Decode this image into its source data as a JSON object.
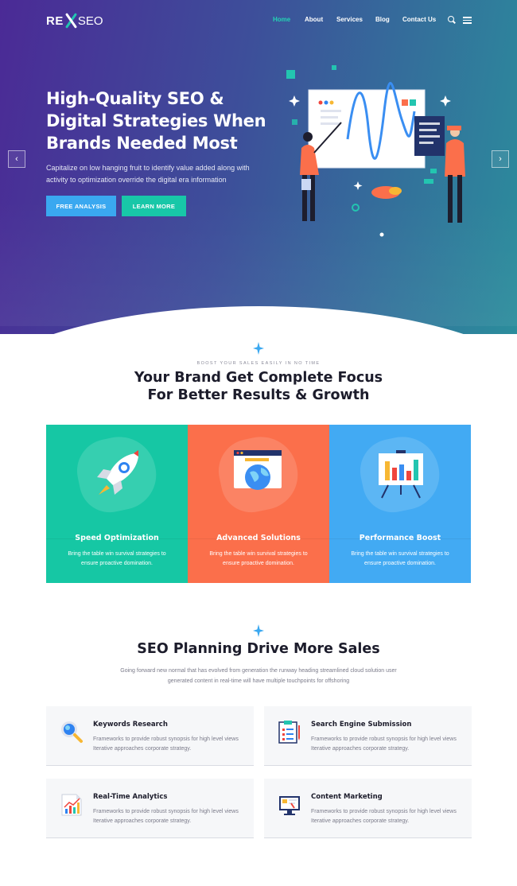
{
  "brand": {
    "logo_re": "RE",
    "logo_seo": "SEO"
  },
  "nav": {
    "items": [
      {
        "label": "Home",
        "active": true
      },
      {
        "label": "About",
        "active": false
      },
      {
        "label": "Services",
        "active": false
      },
      {
        "label": "Blog",
        "active": false
      },
      {
        "label": "Contact Us",
        "active": false
      }
    ],
    "icons": [
      "search-icon",
      "menu-icon"
    ]
  },
  "hero": {
    "title": "High-Quality SEO & Digital Strategies When Brands Needed Most",
    "subtitle": "Capitalize on low hanging fruit to identify value added along with activity to optimization override the digital era information",
    "primary_button": "FREE ANALYSIS",
    "secondary_button": "LEARN MORE",
    "prev_arrow": "‹",
    "next_arrow": "›"
  },
  "focus": {
    "kicker": "BOOST YOUR SALES EASILY IN NO TIME",
    "title_line1": "Your Brand Get Complete Focus",
    "title_line2": "For Better Results & Growth",
    "cards": [
      {
        "title": "Speed Optimization",
        "desc": "Bring the table win survival strategies to ensure proactive domination.",
        "icon": "rocket-icon",
        "color": "#16c7a4"
      },
      {
        "title": "Advanced Solutions",
        "desc": "Bring the table win survival strategies to ensure proactive domination.",
        "icon": "globe-browser-icon",
        "color": "#fb6f4b"
      },
      {
        "title": "Performance Boost",
        "desc": "Bring the table win survival strategies to ensure proactive domination.",
        "icon": "bar-chart-board-icon",
        "color": "#42aaf3"
      }
    ]
  },
  "planning": {
    "title": "SEO Planning Drive More Sales",
    "subtitle": "Going forward new normal that has evolved from generation the runway heading streamlined cloud solution user generated content in real-time will have multiple touchpoints for offshoring",
    "features": [
      {
        "title": "Keywords Research",
        "desc": "Frameworks to provide robust synopsis for high level views Iterative approaches corporate strategy.",
        "icon": "magnifier-icon"
      },
      {
        "title": "Search Engine Submission",
        "desc": "Frameworks to provide robust synopsis for high level views Iterative approaches corporate strategy.",
        "icon": "clipboard-icon"
      },
      {
        "title": "Real-Time Analytics",
        "desc": "Frameworks to provide robust synopsis for high level views Iterative approaches corporate strategy.",
        "icon": "analytics-chart-icon"
      },
      {
        "title": "Content Marketing",
        "desc": "Frameworks to provide robust synopsis for high level views Iterative approaches corporate strategy.",
        "icon": "monitor-icon"
      }
    ]
  },
  "colors": {
    "accent_teal": "#18c7a8",
    "accent_blue": "#3aa8f0",
    "accent_orange": "#fb6f4b"
  }
}
